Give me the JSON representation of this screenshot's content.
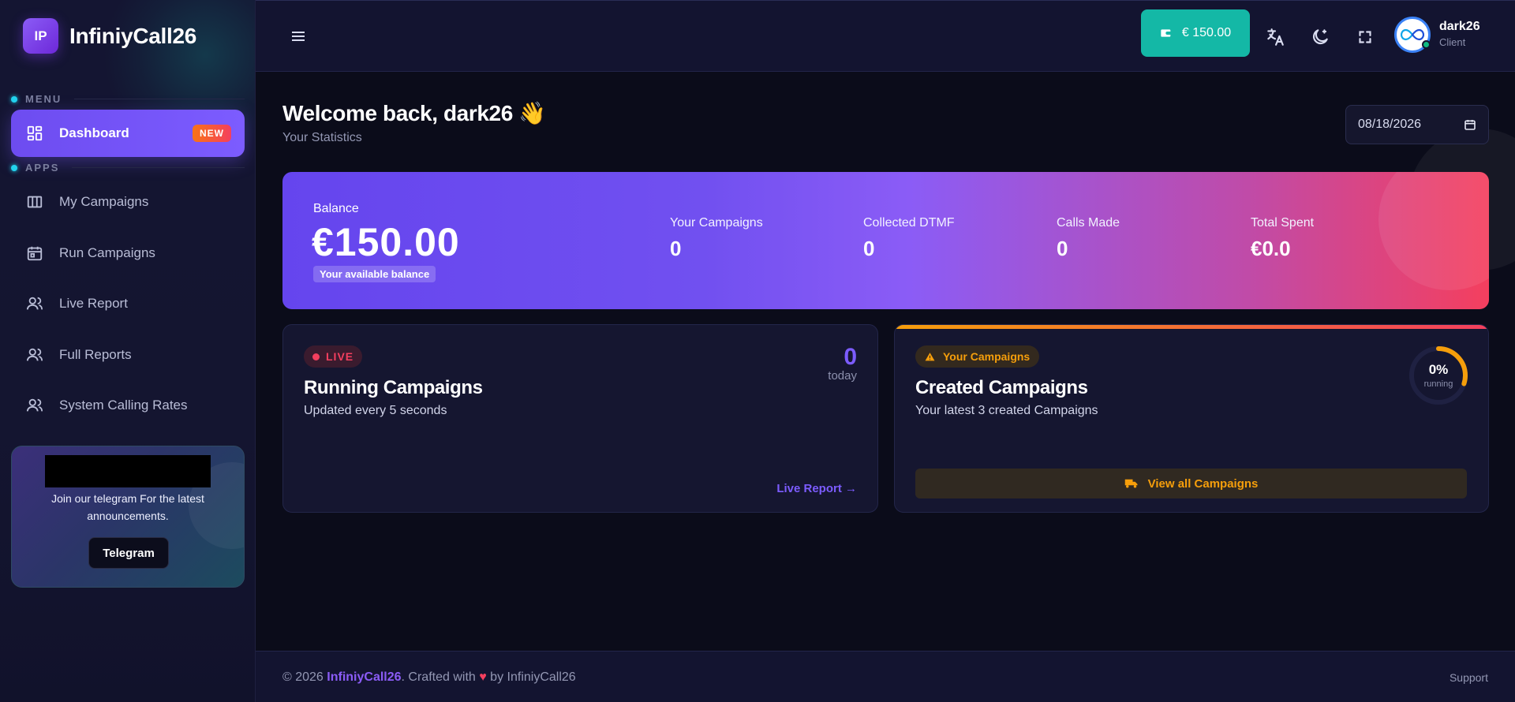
{
  "brand": {
    "logo_text": "IP",
    "name": "InfiniyCall26"
  },
  "sidebar": {
    "menu_label": "MENU",
    "apps_label": "APPS",
    "items": [
      {
        "label": "Dashboard",
        "icon": "dashboard-icon",
        "badge": "NEW",
        "active": true
      },
      {
        "label": "My Campaigns",
        "icon": "columns-icon"
      },
      {
        "label": "Run Campaigns",
        "icon": "calendar-icon"
      },
      {
        "label": "Live Report",
        "icon": "users-icon"
      },
      {
        "label": "Full Reports",
        "icon": "users-icon"
      },
      {
        "label": "System Calling Rates",
        "icon": "users-icon"
      }
    ],
    "promo": {
      "text": "Join our telegram For the latest announcements.",
      "button": "Telegram"
    }
  },
  "header": {
    "wallet": "€ 150.00",
    "user": {
      "name": "dark26",
      "role": "Client"
    }
  },
  "main": {
    "welcome": "Welcome back, dark26 👋",
    "subtitle": "Your Statistics",
    "date": "08/18/2026",
    "balance": {
      "label": "Balance",
      "value": "€150.00",
      "note": "Your available balance",
      "stats": [
        {
          "label": "Your Campaigns",
          "value": "0"
        },
        {
          "label": "Collected DTMF",
          "value": "0"
        },
        {
          "label": "Calls Made",
          "value": "0"
        },
        {
          "label": "Total Spent",
          "value": "€0.0"
        }
      ]
    },
    "running": {
      "badge": "LIVE",
      "title": "Running Campaigns",
      "subtitle": "Updated every 5 seconds",
      "count": "0",
      "count_label": "today",
      "link": "Live Report →"
    },
    "created": {
      "badge": "Your Campaigns",
      "title": "Created Campaigns",
      "subtitle": "Your latest 3 created Campaigns",
      "percent": "0%",
      "percent_value": 0,
      "percent_label": "running",
      "button": "View all Campaigns"
    }
  },
  "footer": {
    "prefix": "© 2026 ",
    "brand": "InfiniyCall26",
    "middle": ". Crafted with ",
    "heart": "♥",
    "suffix": " by InfiniyCall26",
    "support": "Support"
  },
  "colors": {
    "accent": "#7c5cff",
    "teal": "#14b8a6",
    "live": "#f43f5e",
    "warning": "#f59e0b"
  }
}
